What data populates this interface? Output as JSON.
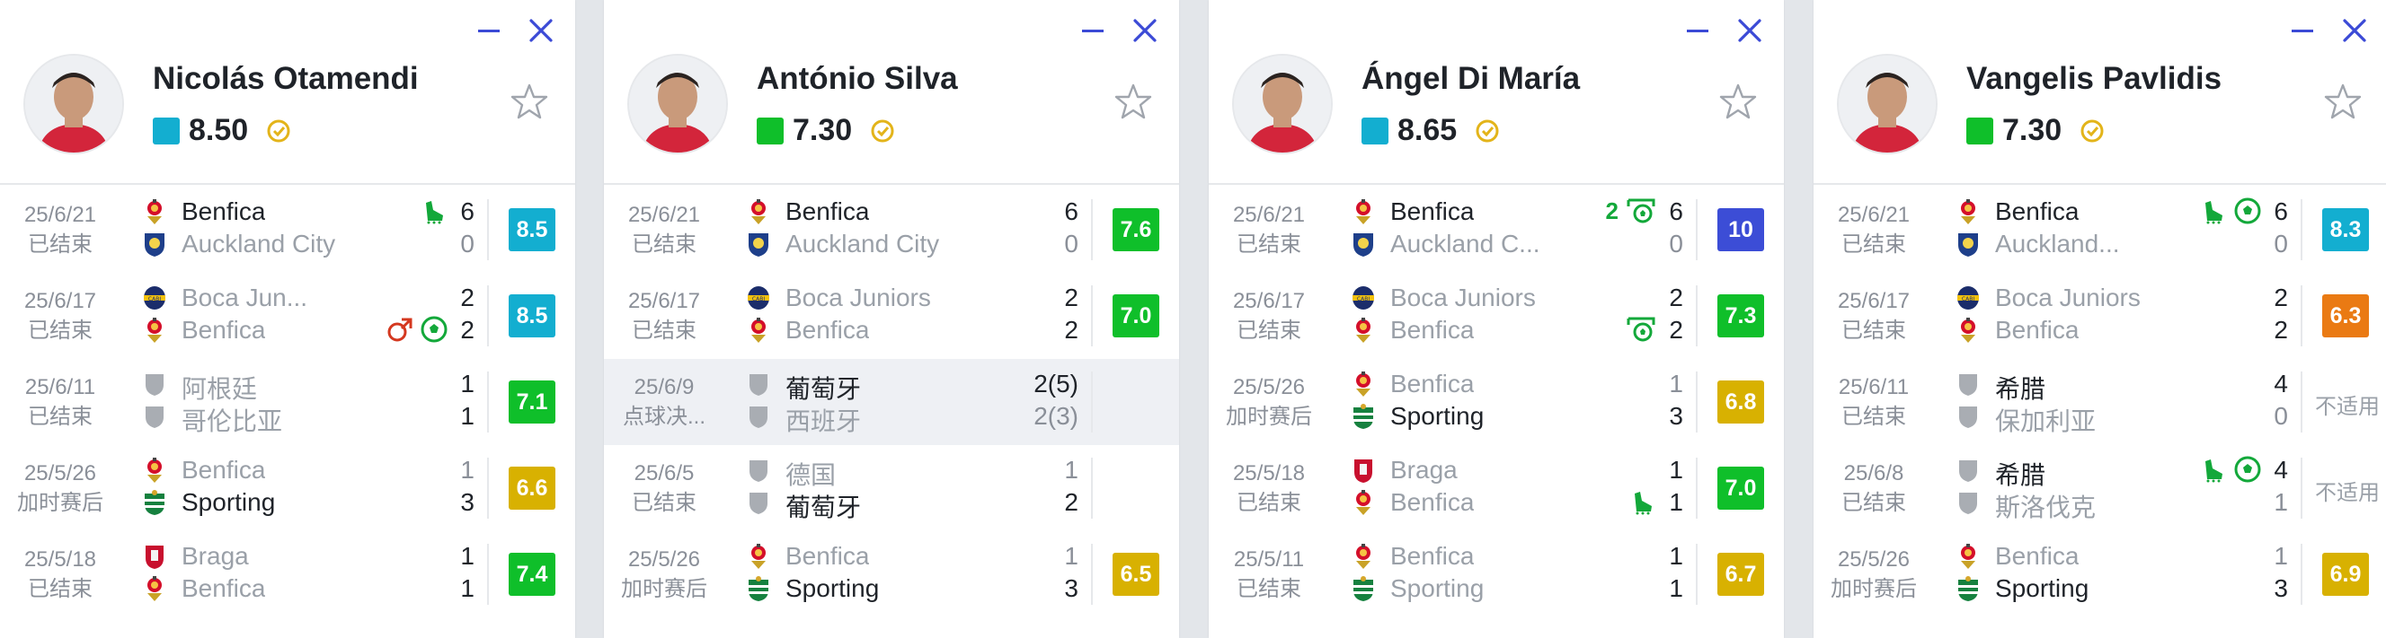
{
  "colors": {
    "green_bright": "#0fbf2a",
    "green_dark": "#0e9f43",
    "cyan": "#13aed0",
    "yellow": "#d8b101",
    "orange": "#ea7a13",
    "blue": "#3c4dd6",
    "accent_ctrl": "#3b4ad6"
  },
  "cards": [
    {
      "player_name": "Nicolás Otamendi",
      "rating": "8.50",
      "rating_color": "#13aed0",
      "matches": [
        {
          "date": "25/6/21",
          "status": "已结束",
          "team1": "Benfica",
          "team2": "Auckland City",
          "c1": "benfica",
          "c2": "auckland",
          "score1": "6",
          "score2": "0",
          "w1": true,
          "w2": false,
          "events1": [
            "boot-assist-icon"
          ],
          "events2": [],
          "rating": "8.5",
          "rcolor": "#13aed0"
        },
        {
          "date": "25/6/17",
          "status": "已结束",
          "team1": "Boca Jun...",
          "team2": "Benfica",
          "c1": "boca",
          "c2": "benfica",
          "score1": "2",
          "score2": "2",
          "w1": false,
          "w2": false,
          "events1": [],
          "events2": [
            "sub-off-icon",
            "goal-icon"
          ],
          "rating": "8.5",
          "rcolor": "#13aed0"
        },
        {
          "date": "25/6/11",
          "status": "已结束",
          "team1": "阿根廷",
          "team2": "哥伦比亚",
          "c1": "shield",
          "c2": "shield",
          "score1": "1",
          "score2": "1",
          "w1": false,
          "w2": false,
          "events1": [],
          "events2": [],
          "rating": "7.1",
          "rcolor": "#0fbf2a"
        },
        {
          "date": "25/5/26",
          "status": "加时赛后",
          "team1": "Benfica",
          "team2": "Sporting",
          "c1": "benfica",
          "c2": "sporting",
          "score1": "1",
          "score2": "3",
          "w1": false,
          "w2": true,
          "events1": [],
          "events2": [],
          "rating": "6.6",
          "rcolor": "#d8b101"
        },
        {
          "date": "25/5/18",
          "status": "已结束",
          "team1": "Braga",
          "team2": "Benfica",
          "c1": "braga",
          "c2": "benfica",
          "score1": "1",
          "score2": "1",
          "w1": false,
          "w2": false,
          "events1": [],
          "events2": [],
          "rating": "7.4",
          "rcolor": "#0fbf2a"
        }
      ]
    },
    {
      "player_name": "António Silva",
      "rating": "7.30",
      "rating_color": "#0fbf2a",
      "matches": [
        {
          "date": "25/6/21",
          "status": "已结束",
          "team1": "Benfica",
          "team2": "Auckland City",
          "c1": "benfica",
          "c2": "auckland",
          "score1": "6",
          "score2": "0",
          "w1": true,
          "w2": false,
          "events1": [],
          "events2": [],
          "rating": "7.6",
          "rcolor": "#0fbf2a"
        },
        {
          "date": "25/6/17",
          "status": "已结束",
          "team1": "Boca Juniors",
          "team2": "Benfica",
          "c1": "boca",
          "c2": "benfica",
          "score1": "2",
          "score2": "2",
          "w1": false,
          "w2": false,
          "events1": [],
          "events2": [],
          "rating": "7.0",
          "rcolor": "#0fbf2a"
        },
        {
          "date": "25/6/9",
          "status": "点球决...",
          "team1": "葡萄牙",
          "team2": "西班牙",
          "c1": "shield",
          "c2": "shield",
          "score1": "2(5)",
          "score2": "2(3)",
          "w1": true,
          "w2": false,
          "events1": [],
          "events2": [],
          "rating": "",
          "rcolor": "",
          "highlight": true
        },
        {
          "date": "25/6/5",
          "status": "已结束",
          "team1": "德国",
          "team2": "葡萄牙",
          "c1": "shield",
          "c2": "shield",
          "score1": "1",
          "score2": "2",
          "w1": false,
          "w2": true,
          "events1": [],
          "events2": [],
          "rating": "",
          "rcolor": ""
        },
        {
          "date": "25/5/26",
          "status": "加时赛后",
          "team1": "Benfica",
          "team2": "Sporting",
          "c1": "benfica",
          "c2": "sporting",
          "score1": "1",
          "score2": "3",
          "w1": false,
          "w2": true,
          "events1": [],
          "events2": [],
          "rating": "6.5",
          "rcolor": "#d8b101"
        }
      ]
    },
    {
      "player_name": "Ángel Di María",
      "rating": "8.65",
      "rating_color": "#13aed0",
      "matches": [
        {
          "date": "25/6/21",
          "status": "已结束",
          "team1": "Benfica",
          "team2": "Auckland C...",
          "c1": "benfica",
          "c2": "auckland",
          "score1": "6",
          "score2": "0",
          "w1": true,
          "w2": false,
          "events1": [
            "two-penalty-goals-icon"
          ],
          "events2": [],
          "events1_prefix": "2",
          "rating": "10",
          "rcolor": "#3c4dd6"
        },
        {
          "date": "25/6/17",
          "status": "已结束",
          "team1": "Boca Juniors",
          "team2": "Benfica",
          "c1": "boca",
          "c2": "benfica",
          "score1": "2",
          "score2": "2",
          "w1": false,
          "w2": false,
          "events1": [],
          "events2": [
            "penalty-goal-icon"
          ],
          "rating": "7.3",
          "rcolor": "#0fbf2a"
        },
        {
          "date": "25/5/26",
          "status": "加时赛后",
          "team1": "Benfica",
          "team2": "Sporting",
          "c1": "benfica",
          "c2": "sporting",
          "score1": "1",
          "score2": "3",
          "w1": false,
          "w2": true,
          "events1": [],
          "events2": [],
          "rating": "6.8",
          "rcolor": "#d8b101"
        },
        {
          "date": "25/5/18",
          "status": "已结束",
          "team1": "Braga",
          "team2": "Benfica",
          "c1": "braga",
          "c2": "benfica",
          "score1": "1",
          "score2": "1",
          "w1": false,
          "w2": false,
          "events1": [],
          "events2": [
            "boot-assist-icon"
          ],
          "rating": "7.0",
          "rcolor": "#0fbf2a"
        },
        {
          "date": "25/5/11",
          "status": "已结束",
          "team1": "Benfica",
          "team2": "Sporting",
          "c1": "benfica",
          "c2": "sporting",
          "score1": "1",
          "score2": "1",
          "w1": false,
          "w2": false,
          "events1": [],
          "events2": [],
          "rating": "6.7",
          "rcolor": "#d8b101"
        }
      ]
    },
    {
      "player_name": "Vangelis Pavlidis",
      "rating": "7.30",
      "rating_color": "#0fbf2a",
      "matches": [
        {
          "date": "25/6/21",
          "status": "已结束",
          "team1": "Benfica",
          "team2": "Auckland...",
          "c1": "benfica",
          "c2": "auckland",
          "score1": "6",
          "score2": "0",
          "w1": true,
          "w2": false,
          "events1": [
            "boot-assist-icon",
            "goal-icon"
          ],
          "events2": [],
          "rating": "8.3",
          "rcolor": "#13aed0"
        },
        {
          "date": "25/6/17",
          "status": "已结束",
          "team1": "Boca Juniors",
          "team2": "Benfica",
          "c1": "boca",
          "c2": "benfica",
          "score1": "2",
          "score2": "2",
          "w1": false,
          "w2": false,
          "events1": [],
          "events2": [],
          "rating": "6.3",
          "rcolor": "#ea7a13"
        },
        {
          "date": "25/6/11",
          "status": "已结束",
          "team1": "希腊",
          "team2": "保加利亚",
          "c1": "shield",
          "c2": "shield",
          "score1": "4",
          "score2": "0",
          "w1": true,
          "w2": false,
          "events1": [],
          "events2": [],
          "rating": "",
          "rcolor": "",
          "na": "不适用"
        },
        {
          "date": "25/6/8",
          "status": "已结束",
          "team1": "希腊",
          "team2": "斯洛伐克",
          "c1": "shield",
          "c2": "shield",
          "score1": "4",
          "score2": "1",
          "w1": true,
          "w2": false,
          "events1": [
            "boot-assist-icon",
            "goal-icon"
          ],
          "events2": [],
          "rating": "",
          "rcolor": "",
          "na": "不适用"
        },
        {
          "date": "25/5/26",
          "status": "加时赛后",
          "team1": "Benfica",
          "team2": "Sporting",
          "c1": "benfica",
          "c2": "sporting",
          "score1": "1",
          "score2": "3",
          "w1": false,
          "w2": true,
          "events1": [],
          "events2": [],
          "rating": "6.9",
          "rcolor": "#d8b101"
        }
      ]
    }
  ]
}
